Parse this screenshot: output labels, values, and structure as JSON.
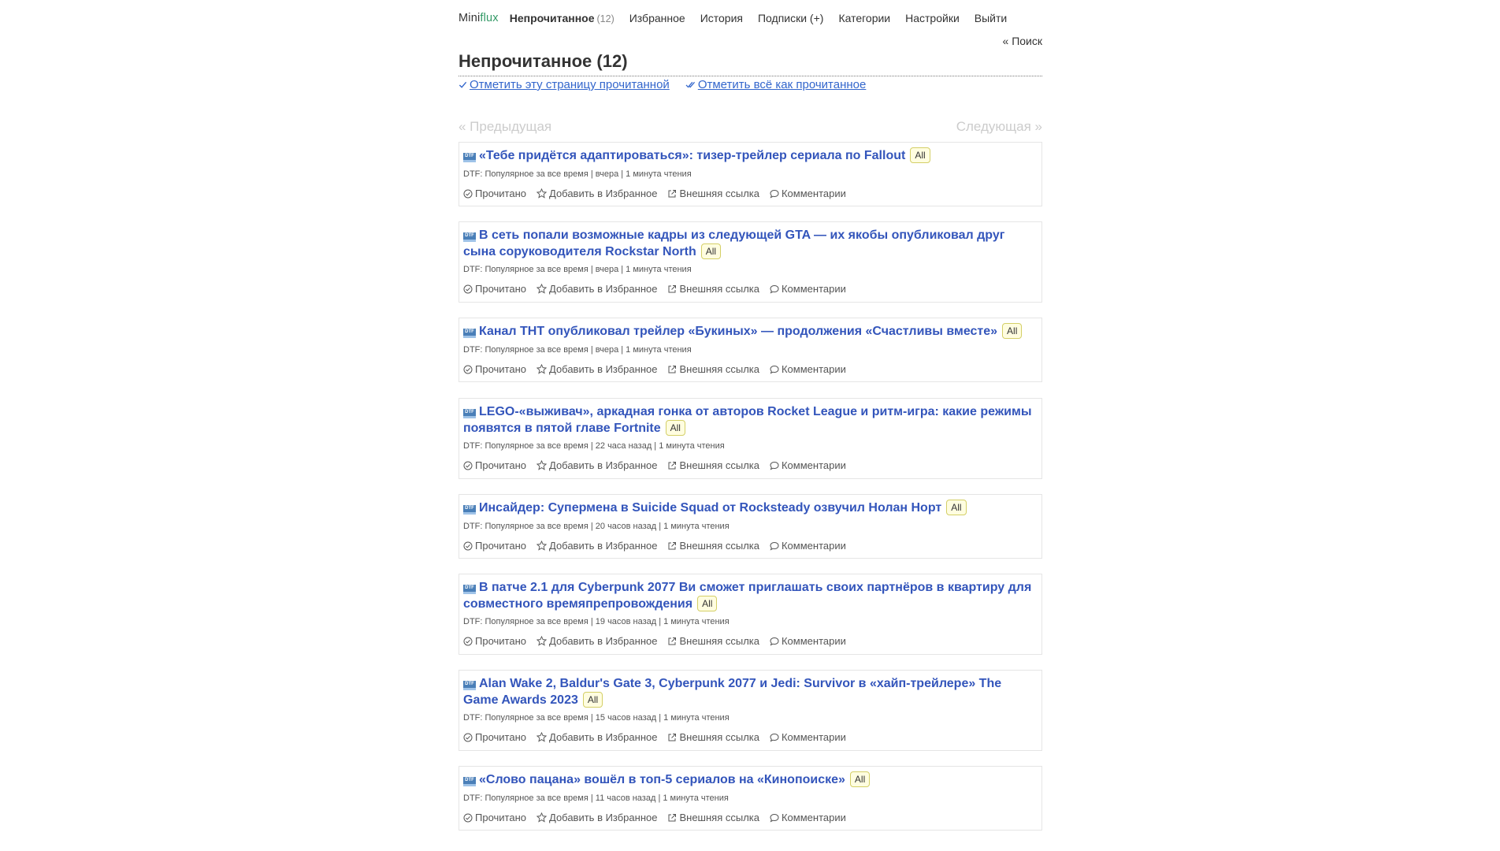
{
  "header": {
    "logo_mini": "Mini",
    "logo_flux": "flux",
    "nav": [
      {
        "label": "Непрочитанное",
        "count": "(12)"
      },
      {
        "label": "Избранное"
      },
      {
        "label": "История"
      },
      {
        "label": "Подписки (+)"
      },
      {
        "label": "Категории"
      },
      {
        "label": "Настройки"
      },
      {
        "label": "Выйти"
      }
    ],
    "search_link": "« Поиск"
  },
  "page": {
    "title": "Непрочитанное (12)",
    "mark_page_read": "Отметить эту страницу прочитанной",
    "mark_all_read": "Отметить всё как прочитанное"
  },
  "pager": {
    "prev": "« Предыдущая",
    "next": "Следующая »"
  },
  "entry_actions": {
    "read": "Прочитано",
    "star": "Добавить в Избранное",
    "external": "Внешняя ссылка",
    "comments": "Комментарии"
  },
  "feed_icon_text": "DTF",
  "entries": [
    {
      "title": "«Тебе придётся адаптироваться»: тизер-трейлер сериала по Fallout",
      "tag": "All",
      "meta": "DTF: Популярное за все время | вчера | 1 минута чтения"
    },
    {
      "title": "В сеть попали возможные кадры из следующей GTA — их якобы опубликовал друг сына соруководителя Rockstar North",
      "tag": "All",
      "meta": "DTF: Популярное за все время | вчера | 1 минута чтения"
    },
    {
      "title": "Канал ТНТ опубликовал трейлер «Букиных» — продолжения «Счастливы вместе»",
      "tag": "All",
      "meta": "DTF: Популярное за все время | вчера | 1 минута чтения"
    },
    {
      "title": "LEGO-«выживач», аркадная гонка от авторов Rocket League и ритм-игра: какие режимы появятся в пятой главе Fortnite",
      "tag": "All",
      "meta": "DTF: Популярное за все время | 22 часа назад | 1 минута чтения"
    },
    {
      "title": "Инсайдер: Супермена в Suicide Squad от Rocksteady озвучил Нолан Норт",
      "tag": "All",
      "meta": "DTF: Популярное за все время | 20 часов назад | 1 минута чтения"
    },
    {
      "title": "В патче 2.1 для Cyberpunk 2077 Ви сможет приглашать своих партнёров в квартиру для совместного времяпрепровождения",
      "tag": "All",
      "meta": "DTF: Популярное за все время | 19 часов назад | 1 минута чтения"
    },
    {
      "title": "Alan Wake 2, Baldur's Gate 3, Cyberpunk 2077 и Jedi: Survivor в «хайп-трейлере» The Game Awards 2023",
      "tag": "All",
      "meta": "DTF: Популярное за все время | 15 часов назад | 1 минута чтения"
    },
    {
      "title": "«Слово пацана» вошёл в топ-5 сериалов на «Кинопоиске»",
      "tag": "All",
      "meta": "DTF: Популярное за все время | 11 часов назад | 1 минута чтения"
    }
  ],
  "colors": {
    "link": "#3355bb",
    "logo_flux": "#339966",
    "tag_bg": "#fffde0",
    "tag_border": "#d4cf66"
  }
}
